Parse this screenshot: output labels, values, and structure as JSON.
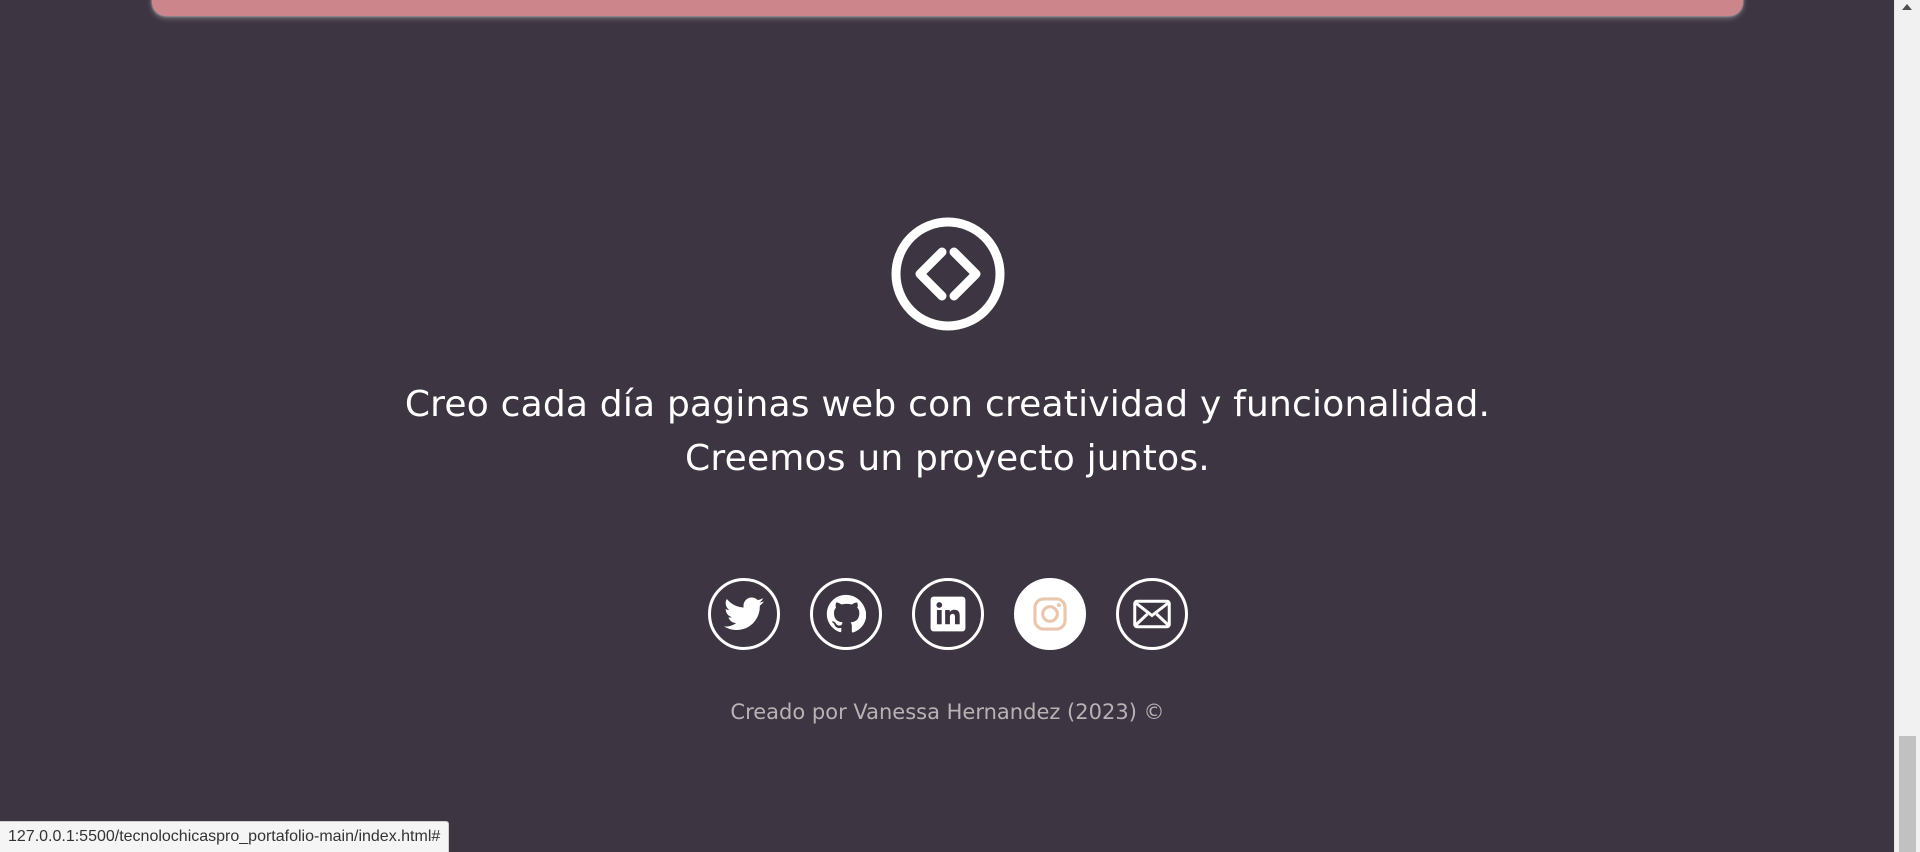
{
  "footer": {
    "tagline_line1": "Creo cada día paginas web con creatividad y funcionalidad.",
    "tagline_line2": "Creemos un proyecto juntos.",
    "credit": "Creado por Vanessa Hernandez (2023) ©",
    "logo_icon": "code-circle-icon",
    "social_links": [
      {
        "name": "twitter",
        "icon": "twitter-icon",
        "active": false
      },
      {
        "name": "github",
        "icon": "github-icon",
        "active": false
      },
      {
        "name": "linkedin",
        "icon": "linkedin-icon",
        "active": false
      },
      {
        "name": "instagram",
        "icon": "instagram-icon",
        "active": true
      },
      {
        "name": "email",
        "icon": "email-icon",
        "active": false
      }
    ]
  },
  "status_bar": {
    "url": "127.0.0.1:5500/tecnolochicaspro_portafolio-main/index.html#"
  },
  "colors": {
    "background": "#3d3541",
    "card": "#cc858a",
    "text": "#ffffff",
    "muted_text": "#b9b2b5",
    "instagram_accent": "#e9c7ae"
  }
}
